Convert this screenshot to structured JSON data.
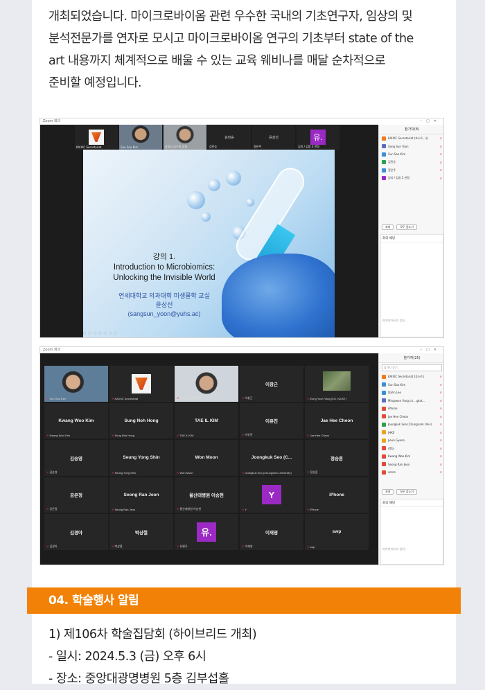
{
  "intro": {
    "line0": "",
    "line1": "개최되었습니다. 마이크로바이옴 관련 우수한 국내의 기초연구자, 임상의 및",
    "line2": "분석전문가를 연자로 모시고 마이크로바이옴 연구의 기초부터 state of the",
    "line3": "art 내용까지 체계적으로 배울 수 있는 교육 웨비나를 매달 순차적으로",
    "line4": "준비할 예정입니다."
  },
  "shot1": {
    "window_title": "Zoom 회의",
    "strip": [
      {
        "name": "KAIXIC Secretariat",
        "kind": "logo"
      },
      {
        "name": "Sun Soo Kim",
        "kind": "face"
      },
      {
        "name": "상상사 교수의 교실",
        "kind": "face"
      },
      {
        "name": "김민승",
        "kind": "text",
        "label": "김민승"
      },
      {
        "name": "정은주",
        "kind": "text",
        "label": "윤상선"
      },
      {
        "name": "김미 / 김범 3 판정",
        "kind": "yu",
        "label": "유."
      }
    ],
    "slide": {
      "title_num": "강의 1.",
      "title_line1": "Introduction to Microbiomics:",
      "title_line2": "Unlocking the Invisible World",
      "affiliation": "연세대학교 의과대학 미생물학 교실",
      "speaker": "윤상선",
      "email": "(sangsun_yoon@yuhs.ac)"
    },
    "panel": {
      "title": "참가자(8)",
      "participants": [
        {
          "name": "KAIXIC Secretariat (호스트, 나)",
          "color": "#f07a1c"
        },
        {
          "name": "Sang Sun Yoon",
          "color": "#5b6cc2"
        },
        {
          "name": "Sun Soo Kim",
          "color": "#3a8ed8"
        },
        {
          "name": "김민승",
          "color": "#2aa24a"
        },
        {
          "name": "정은주",
          "color": "#3a8ed8"
        },
        {
          "name": "김미 / 김범 3 판정",
          "color": "#9b2ac4"
        }
      ],
      "invite_label": "초대",
      "mute_all_label": "모두 음소거",
      "chat_title": "회의 채팅",
      "chat_placeholder": "여기에 메시지 입력..."
    }
  },
  "shot2": {
    "window_title": "Zoom 회의",
    "tiles": [
      {
        "label": "",
        "tag": "Sun Soo Kim",
        "kind": "video",
        "active": true
      },
      {
        "label": "",
        "tag": "KAIXIC Secretariat",
        "kind": "logo"
      },
      {
        "label": "",
        "tag": "상상사 교수의 교실",
        "kind": "video2"
      },
      {
        "label": "이창근",
        "tag": "이창근",
        "kind": "text"
      },
      {
        "label": "",
        "tag": "Eung Yoon Yang (KU, KAIST)",
        "kind": "video3"
      },
      {
        "label": "Kwang Woo Kim",
        "tag": "Kwang Woo Kim",
        "kind": "text"
      },
      {
        "label": "Sung Noh Hong",
        "tag": "Sung Noh Hong",
        "kind": "text"
      },
      {
        "label": "TAE IL KIM",
        "tag": "TAE IL KIM",
        "kind": "text"
      },
      {
        "label": "이유진",
        "tag": "이유진",
        "kind": "text"
      },
      {
        "label": "Jae Hee Cheon",
        "tag": "Jae Hee Cheon",
        "kind": "text"
      },
      {
        "label": "김승영",
        "tag": "김승영",
        "kind": "text"
      },
      {
        "label": "Seung Yong Shin",
        "tag": "Seung Yong Shin",
        "kind": "text"
      },
      {
        "label": "Won Moon",
        "tag": "Won Moon",
        "kind": "text"
      },
      {
        "label": "Joongkuk Seo (C...",
        "tag": "Joongkuk Seo (Chungnam University)",
        "kind": "text"
      },
      {
        "label": "정승훈",
        "tag": "정승훈",
        "kind": "text"
      },
      {
        "label": "공은정",
        "tag": "공은정",
        "kind": "text"
      },
      {
        "label": "Seong Ran Jeon",
        "tag": "Seong Ran Jeon",
        "kind": "text"
      },
      {
        "label": "울산대병원 이승현",
        "tag": "울산대병원 이승현",
        "kind": "text"
      },
      {
        "label": "Y",
        "tag": "Y",
        "kind": "sq",
        "color": "#9b2ac4"
      },
      {
        "label": "iPhone",
        "tag": "iPhone",
        "kind": "text"
      },
      {
        "label": "김경아",
        "tag": "김경아",
        "kind": "text"
      },
      {
        "label": "박상철",
        "tag": "박상철",
        "kind": "text"
      },
      {
        "label": "유.",
        "tag": "유현주",
        "kind": "sq",
        "color": "#9b2ac4"
      },
      {
        "label": "이재영",
        "tag": "이재영",
        "kind": "text"
      },
      {
        "label": "swp",
        "tag": "swp",
        "kind": "text"
      }
    ],
    "panel": {
      "title": "참가자(25)",
      "search_placeholder": "참가자 찾기",
      "participants": [
        {
          "name": "KAIXIC Secretariat (호스트)",
          "color": "#f07a1c"
        },
        {
          "name": "Sun Soo Kim",
          "color": "#3a8ed8"
        },
        {
          "name": "Dahn Lee",
          "color": "#3a8ed8"
        },
        {
          "name": "Mingseon Yong ch... gkst...",
          "color": "#5b6cc2"
        },
        {
          "name": "iPhone",
          "color": "#e04a3a"
        },
        {
          "name": "Jae Hee Cheon",
          "color": "#e04a3a"
        },
        {
          "name": "Joongkuk Seo (Chungnam Univ)",
          "color": "#2aa24a"
        },
        {
          "name": "JHKS",
          "color": "#e8a21c"
        },
        {
          "name": "Jieun Gyeon",
          "color": "#e8a21c"
        },
        {
          "name": "dTbi",
          "color": "#e04a3a"
        },
        {
          "name": "Kwang Woo Kim",
          "color": "#e04a3a"
        },
        {
          "name": "Seong Ran Jeon",
          "color": "#e04a3a"
        },
        {
          "name": "sonm",
          "color": "#e04a3a"
        }
      ],
      "invite_label": "초대",
      "mute_all_label": "모두 음소거",
      "chat_title": "회의 채팅",
      "chat_placeholder": "여기에 메시지 입력..."
    }
  },
  "section": {
    "title": "04. 학술행사 알림"
  },
  "event": {
    "line1": "1) 제106차 학술집담회 (하이브리드 개최)",
    "line2": "- 일시: 2024.5.3 (금) 오후 6시",
    "line3": "- 장소: 중앙대광명병원 5층 김부섭홀"
  }
}
